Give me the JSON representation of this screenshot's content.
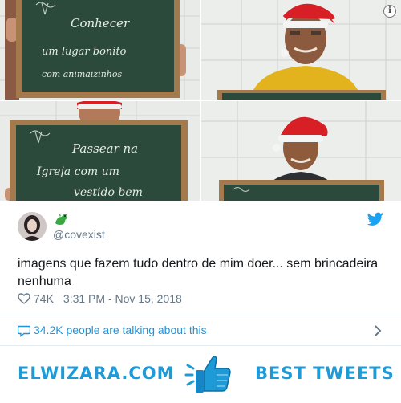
{
  "photos": {
    "items": [
      {
        "board_lines": [
          "Conhecer",
          "um lugar bonito",
          "com  animaizinhos"
        ]
      },
      {
        "board_lines": []
      },
      {
        "board_lines": [
          "Passear na",
          "Igreja com um",
          "vestido bem"
        ]
      },
      {
        "board_lines": []
      }
    ],
    "info_icon": "info-icon",
    "info_glyph": "i"
  },
  "tweet": {
    "handle": "@covexist",
    "text": "imagens que fazem tudo dentro de mim doer... sem brincadeira nenhuma",
    "likes": "74K",
    "timestamp": "3:31 PM - Nov 15, 2018",
    "talking": "34.2K people are talking about this",
    "icons": [
      "dragon-emoji-icon",
      "twitter-bird-icon",
      "heart-icon",
      "speech-bubble-icon",
      "chevron-right-icon"
    ],
    "colors": {
      "link": "#1b95e0",
      "muted": "#657786",
      "text": "#14171a",
      "divider": "#e1e8ed"
    }
  },
  "banner": {
    "left": "ELWIZARA.COM",
    "right": "BEST TWEETS",
    "icon": "thumbs-up-icon",
    "color": "#1e9ad6"
  }
}
